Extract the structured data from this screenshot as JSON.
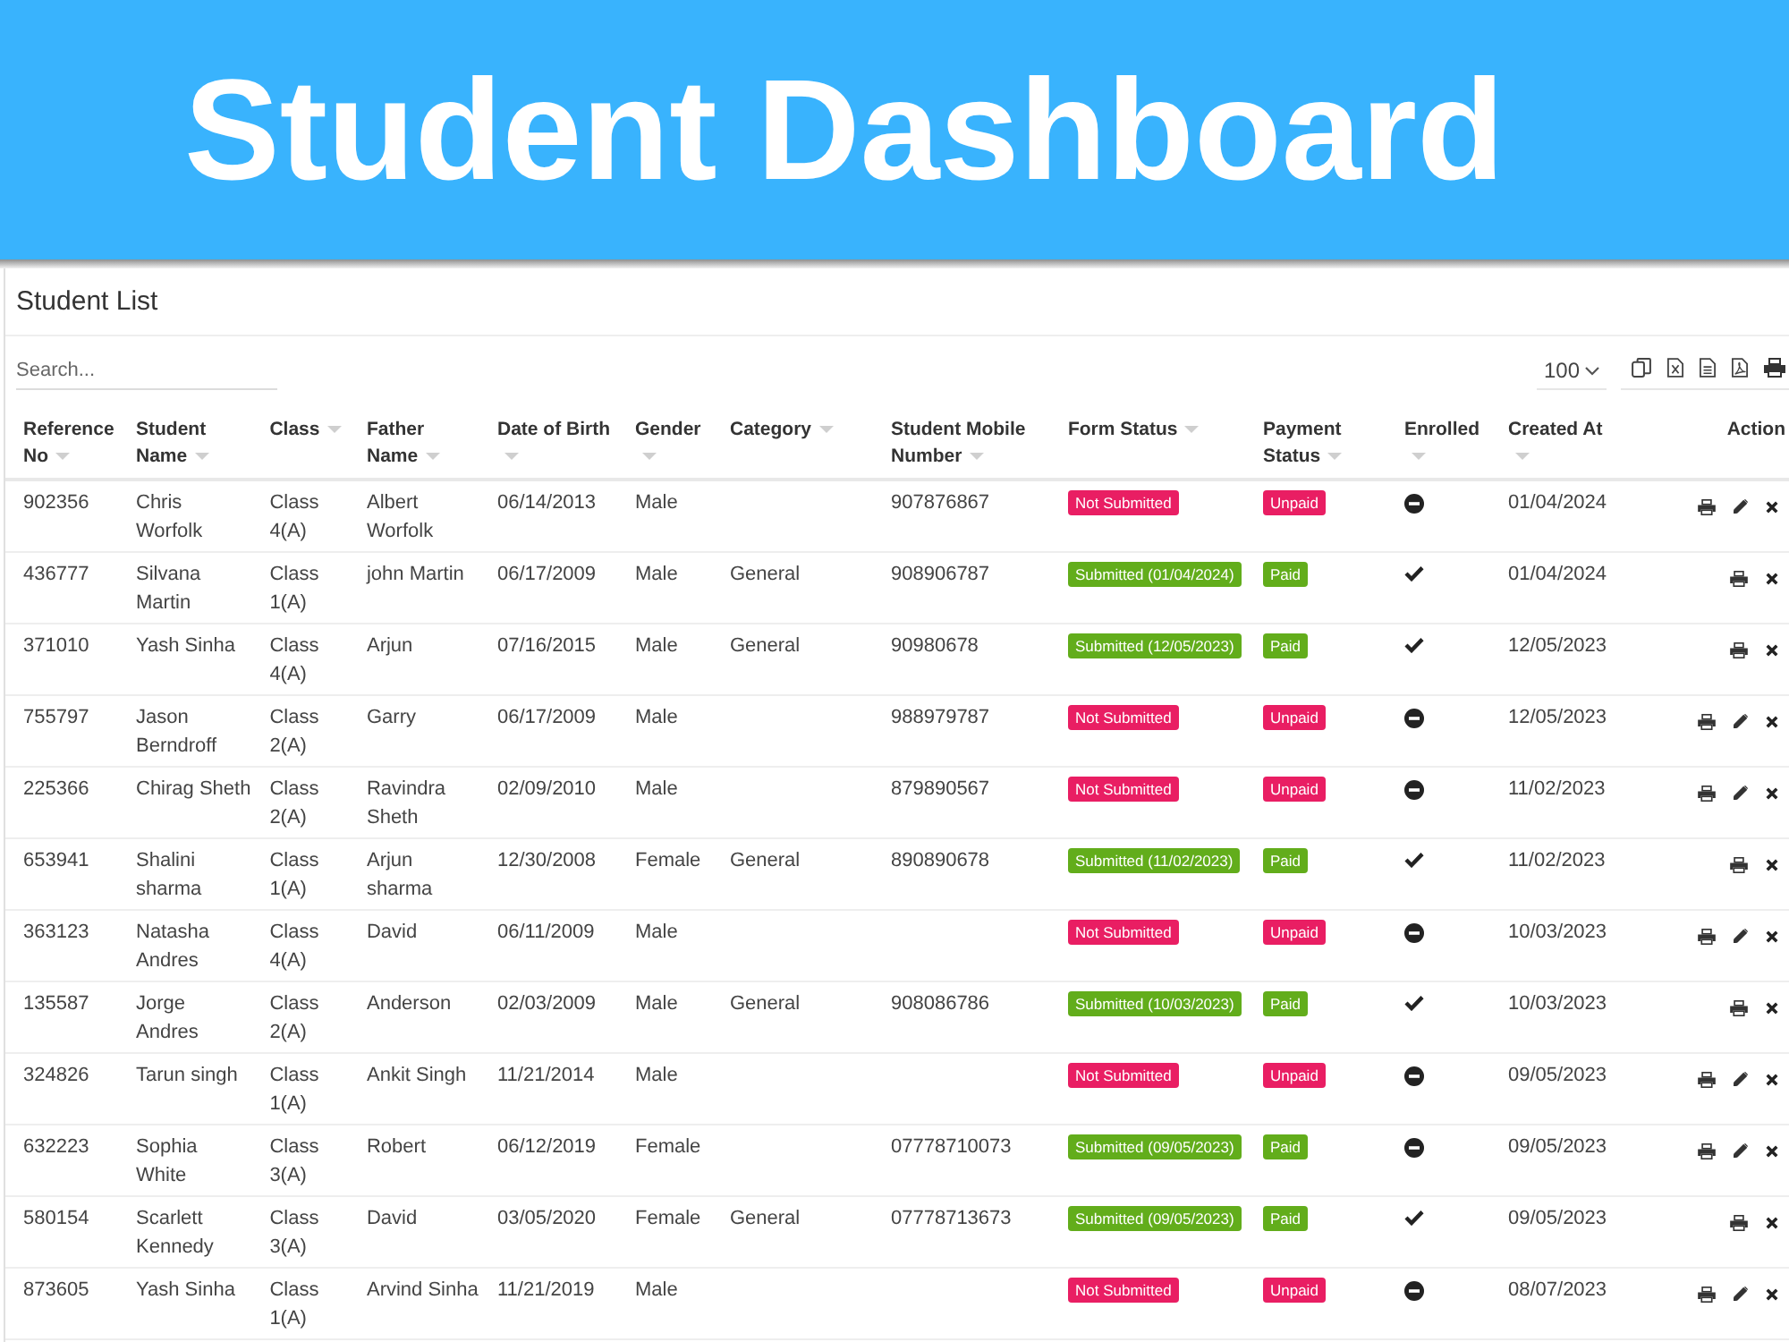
{
  "banner": {
    "title": "Student Dashboard"
  },
  "card": {
    "title": "Student List"
  },
  "search": {
    "placeholder": "Search..."
  },
  "page_size": {
    "value": "100"
  },
  "table": {
    "columns": [
      {
        "label": "Reference No",
        "sortable": true
      },
      {
        "label": "Student Name",
        "sortable": true
      },
      {
        "label": "Class",
        "sortable": true
      },
      {
        "label": "Father Name",
        "sortable": true
      },
      {
        "label": "Date of Birth",
        "sortable": true
      },
      {
        "label": "Gender",
        "sortable": true
      },
      {
        "label": "Category",
        "sortable": true
      },
      {
        "label": "Student Mobile Number",
        "sortable": true
      },
      {
        "label": "Form Status",
        "sortable": true
      },
      {
        "label": "Payment Status",
        "sortable": true
      },
      {
        "label": "Enrolled",
        "sortable": true
      },
      {
        "label": "Created At",
        "sortable": true
      },
      {
        "label": "Action",
        "sortable": false
      }
    ],
    "rows": [
      {
        "reference_no": "902356",
        "student_name": "Chris Worfolk",
        "class": "Class 4(A)",
        "father_name": "Albert Worfolk",
        "date_of_birth": "06/14/2013",
        "gender": "Male",
        "mobile": "907876867",
        "form_status": {
          "text": "Not Submitted",
          "submitted": false
        },
        "payment_status": {
          "text": "Unpaid",
          "paid": false
        },
        "enrolled": false,
        "created_at": "01/04/2024",
        "actions": [
          {
            "kind": "print"
          },
          {
            "kind": "edit"
          },
          {
            "kind": "delete"
          }
        ]
      },
      {
        "reference_no": "436777",
        "student_name": "Silvana Martin",
        "class": "Class 1(A)",
        "father_name": "john Martin",
        "date_of_birth": "06/17/2009",
        "gender": "Male",
        "category": "General",
        "mobile": "908906787",
        "form_status": {
          "text": "Submitted (01/04/2024)",
          "submitted": true
        },
        "payment_status": {
          "text": "Paid",
          "paid": true
        },
        "enrolled": true,
        "created_at": "01/04/2024",
        "actions": [
          {
            "kind": "print"
          },
          {
            "kind": "delete"
          }
        ]
      },
      {
        "reference_no": "371010",
        "student_name": "Yash Sinha",
        "class": "Class 4(A)",
        "father_name": "Arjun",
        "date_of_birth": "07/16/2015",
        "gender": "Male",
        "category": "General",
        "mobile": "90980678",
        "form_status": {
          "text": "Submitted (12/05/2023)",
          "submitted": true
        },
        "payment_status": {
          "text": "Paid",
          "paid": true
        },
        "enrolled": true,
        "created_at": "12/05/2023",
        "actions": [
          {
            "kind": "print"
          },
          {
            "kind": "delete"
          }
        ]
      },
      {
        "reference_no": "755797",
        "student_name": "Jason Berndroff",
        "class": "Class 2(A)",
        "father_name": "Garry",
        "date_of_birth": "06/17/2009",
        "gender": "Male",
        "mobile": "988979787",
        "form_status": {
          "text": "Not Submitted",
          "submitted": false
        },
        "payment_status": {
          "text": "Unpaid",
          "paid": false
        },
        "enrolled": false,
        "created_at": "12/05/2023",
        "actions": [
          {
            "kind": "print"
          },
          {
            "kind": "edit"
          },
          {
            "kind": "delete"
          }
        ]
      },
      {
        "reference_no": "225366",
        "student_name": "Chirag Sheth",
        "class": "Class 2(A)",
        "father_name": "Ravindra Sheth",
        "date_of_birth": "02/09/2010",
        "gender": "Male",
        "mobile": "879890567",
        "form_status": {
          "text": "Not Submitted",
          "submitted": false
        },
        "payment_status": {
          "text": "Unpaid",
          "paid": false
        },
        "enrolled": false,
        "created_at": "11/02/2023",
        "actions": [
          {
            "kind": "print"
          },
          {
            "kind": "edit"
          },
          {
            "kind": "delete"
          }
        ]
      },
      {
        "reference_no": "653941",
        "student_name": "Shalini sharma",
        "class": "Class 1(A)",
        "father_name": "Arjun sharma",
        "date_of_birth": "12/30/2008",
        "gender": "Female",
        "category": "General",
        "mobile": "890890678",
        "form_status": {
          "text": "Submitted (11/02/2023)",
          "submitted": true
        },
        "payment_status": {
          "text": "Paid",
          "paid": true
        },
        "enrolled": true,
        "created_at": "11/02/2023",
        "actions": [
          {
            "kind": "print"
          },
          {
            "kind": "delete"
          }
        ]
      },
      {
        "reference_no": "363123",
        "student_name": "Natasha Andres",
        "class": "Class 4(A)",
        "father_name": "David",
        "date_of_birth": "06/11/2009",
        "gender": "Male",
        "form_status": {
          "text": "Not Submitted",
          "submitted": false
        },
        "payment_status": {
          "text": "Unpaid",
          "paid": false
        },
        "enrolled": false,
        "created_at": "10/03/2023",
        "actions": [
          {
            "kind": "print"
          },
          {
            "kind": "edit"
          },
          {
            "kind": "delete"
          }
        ]
      },
      {
        "reference_no": "135587",
        "student_name": "Jorge Andres",
        "class": "Class 2(A)",
        "father_name": "Anderson",
        "date_of_birth": "02/03/2009",
        "gender": "Male",
        "category": "General",
        "mobile": "908086786",
        "form_status": {
          "text": "Submitted (10/03/2023)",
          "submitted": true
        },
        "payment_status": {
          "text": "Paid",
          "paid": true
        },
        "enrolled": true,
        "created_at": "10/03/2023",
        "actions": [
          {
            "kind": "print"
          },
          {
            "kind": "delete"
          }
        ]
      },
      {
        "reference_no": "324826",
        "student_name": "Tarun singh",
        "class": "Class 1(A)",
        "father_name": "Ankit Singh",
        "date_of_birth": "11/21/2014",
        "gender": "Male",
        "form_status": {
          "text": "Not Submitted",
          "submitted": false
        },
        "payment_status": {
          "text": "Unpaid",
          "paid": false
        },
        "enrolled": false,
        "created_at": "09/05/2023",
        "actions": [
          {
            "kind": "print"
          },
          {
            "kind": "edit"
          },
          {
            "kind": "delete"
          }
        ]
      },
      {
        "reference_no": "632223",
        "student_name": "Sophia White",
        "class": "Class 3(A)",
        "father_name": "Robert",
        "date_of_birth": "06/12/2019",
        "gender": "Female",
        "mobile": "07778710073",
        "form_status": {
          "text": "Submitted (09/05/2023)",
          "submitted": true
        },
        "payment_status": {
          "text": "Paid",
          "paid": true
        },
        "enrolled": false,
        "created_at": "09/05/2023",
        "actions": [
          {
            "kind": "print"
          },
          {
            "kind": "edit"
          },
          {
            "kind": "delete"
          }
        ]
      },
      {
        "reference_no": "580154",
        "student_name": "Scarlett Kennedy",
        "class": "Class 3(A)",
        "father_name": "David",
        "date_of_birth": "03/05/2020",
        "gender": "Female",
        "category": "General",
        "mobile": "07778713673",
        "form_status": {
          "text": "Submitted (09/05/2023)",
          "submitted": true
        },
        "payment_status": {
          "text": "Paid",
          "paid": true
        },
        "enrolled": true,
        "created_at": "09/05/2023",
        "actions": [
          {
            "kind": "print"
          },
          {
            "kind": "delete"
          }
        ]
      },
      {
        "reference_no": "873605",
        "student_name": "Yash Sinha",
        "class": "Class 1(A)",
        "father_name": "Arvind Sinha",
        "date_of_birth": "11/21/2019",
        "gender": "Male",
        "form_status": {
          "text": "Not Submitted",
          "submitted": false
        },
        "payment_status": {
          "text": "Unpaid",
          "paid": false
        },
        "enrolled": false,
        "created_at": "08/07/2023",
        "actions": [
          {
            "kind": "print"
          },
          {
            "kind": "edit"
          },
          {
            "kind": "delete"
          }
        ]
      }
    ]
  }
}
